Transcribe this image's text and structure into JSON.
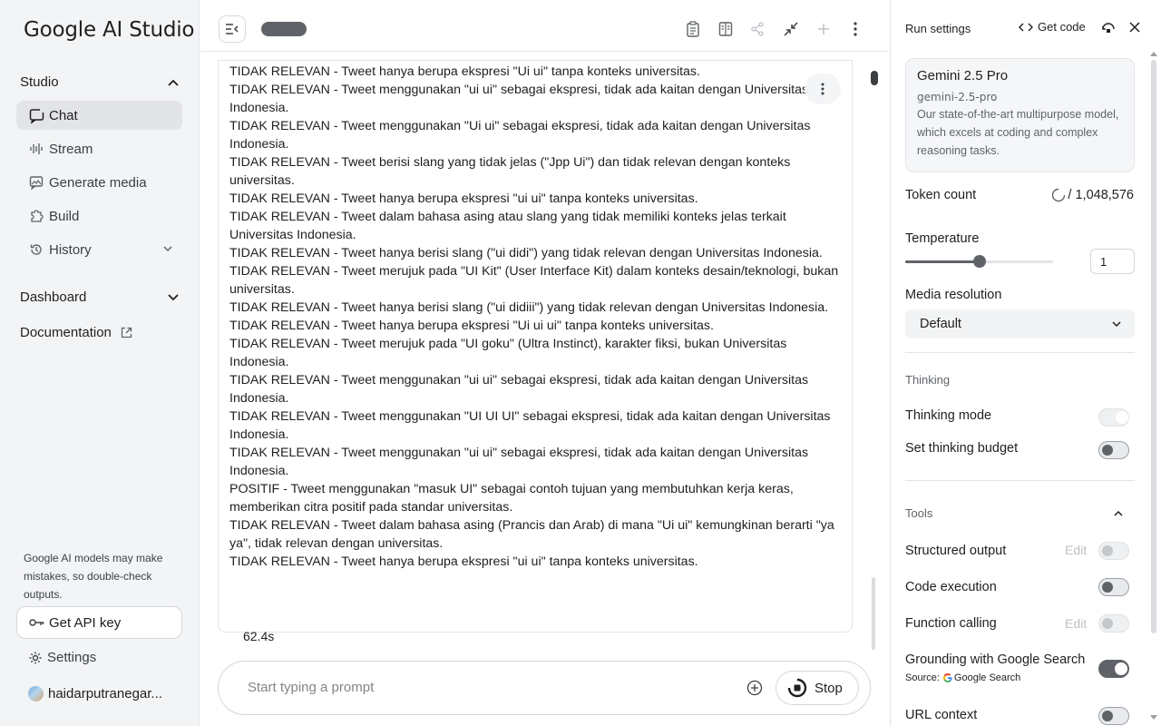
{
  "sidebar": {
    "logo": "Google AI Studio",
    "studio_label": "Studio",
    "items": [
      {
        "label": "Chat",
        "icon": "chat-icon"
      },
      {
        "label": "Stream",
        "icon": "stream-icon"
      },
      {
        "label": "Generate media",
        "icon": "media-icon"
      },
      {
        "label": "Build",
        "icon": "build-icon"
      },
      {
        "label": "History",
        "icon": "history-icon"
      }
    ],
    "dashboard_label": "Dashboard",
    "documentation_label": "Documentation",
    "disclaimer": "Google AI models may make mistakes, so double-check outputs.",
    "api_key_label": "Get API key",
    "settings_label": "Settings",
    "user_name": "haidarputranegar..."
  },
  "response": {
    "lines": [
      "TIDAK RELEVAN - Tweet hanya berupa ekspresi \"Ui ui\" tanpa konteks universitas.",
      "TIDAK RELEVAN - Tweet menggunakan \"ui ui\" sebagai ekspresi, tidak ada kaitan dengan Universitas Indonesia.",
      "TIDAK RELEVAN - Tweet menggunakan \"Ui ui\" sebagai ekspresi, tidak ada kaitan dengan Universitas Indonesia.",
      "TIDAK RELEVAN - Tweet berisi slang yang tidak jelas (\"Jpp Ui\") dan tidak relevan dengan konteks universitas.",
      "TIDAK RELEVAN - Tweet hanya berupa ekspresi \"ui ui\" tanpa konteks universitas.",
      "TIDAK RELEVAN - Tweet dalam bahasa asing atau slang yang tidak memiliki konteks jelas terkait Universitas Indonesia.",
      "TIDAK RELEVAN - Tweet hanya berisi slang (\"ui didi\") yang tidak relevan dengan Universitas Indonesia.",
      "TIDAK RELEVAN - Tweet merujuk pada \"UI Kit\" (User Interface Kit) dalam konteks desain/teknologi, bukan universitas.",
      "TIDAK RELEVAN - Tweet hanya berisi slang (\"ui didiii\") yang tidak relevan dengan Universitas Indonesia.",
      "TIDAK RELEVAN - Tweet hanya berupa ekspresi \"Ui ui ui\" tanpa konteks universitas.",
      "TIDAK RELEVAN - Tweet merujuk pada \"UI goku\" (Ultra Instinct), karakter fiksi, bukan Universitas Indonesia.",
      "TIDAK RELEVAN - Tweet menggunakan \"ui ui\" sebagai ekspresi, tidak ada kaitan dengan Universitas Indonesia.",
      "TIDAK RELEVAN - Tweet menggunakan \"UI UI UI\" sebagai ekspresi, tidak ada kaitan dengan Universitas Indonesia.",
      "TIDAK RELEVAN - Tweet menggunakan \"ui ui\" sebagai ekspresi, tidak ada kaitan dengan Universitas Indonesia.",
      "POSITIF - Tweet menggunakan \"masuk UI\" sebagai contoh tujuan yang membutuhkan kerja keras, memberikan citra positif pada standar universitas.",
      "TIDAK RELEVAN - Tweet dalam bahasa asing (Prancis dan Arab) di mana \"Ui ui\" kemungkinan berarti \"ya ya\", tidak relevan dengan universitas.",
      "TIDAK RELEVAN - Tweet hanya berupa ekspresi \"ui ui\" tanpa konteks universitas."
    ],
    "elapsed": "62.4s"
  },
  "prompt": {
    "placeholder": "Start typing a prompt",
    "stop_label": "Stop"
  },
  "run_settings": {
    "title": "Run settings",
    "get_code_label": "Get code",
    "model": {
      "name": "Gemini 2.5 Pro",
      "id": "gemini-2.5-pro",
      "description": "Our state-of-the-art multipurpose model, which excels at coding and complex reasoning tasks."
    },
    "token_count_label": "Token count",
    "token_count_value": "/ 1,048,576",
    "temperature_label": "Temperature",
    "temperature_value": "1",
    "temperature_max": 2,
    "media_resolution_label": "Media resolution",
    "media_resolution_value": "Default",
    "thinking_section": "Thinking",
    "thinking_mode_label": "Thinking mode",
    "thinking_budget_label": "Set thinking budget",
    "tools_section": "Tools",
    "structured_output_label": "Structured output",
    "code_execution_label": "Code execution",
    "function_calling_label": "Function calling",
    "edit_label": "Edit",
    "grounding_label": "Grounding with Google Search",
    "source_label": "Source:",
    "source_value": "Google Search",
    "url_context_label": "URL context"
  },
  "colors": {
    "accent": "#5f6368",
    "sidebar_bg": "#f3f4f6",
    "google_blue": "#4285f4",
    "google_red": "#ea4335",
    "google_yellow": "#fbbc05",
    "google_green": "#34a853"
  }
}
